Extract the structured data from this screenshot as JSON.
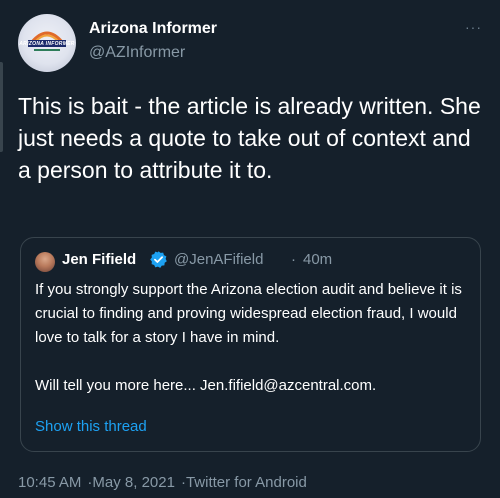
{
  "author": {
    "name": "Arizona Informer",
    "handle": "@AZInformer",
    "avatar_text": "ARIZONA INFORMER"
  },
  "tweet": {
    "text": "This is bait - the article is already written. She just needs a quote to take out of context and a person to attribute it to."
  },
  "quoted": {
    "name": "Jen Fifield",
    "handle": "@JenAFifield",
    "separator": "·",
    "time": "40m",
    "body": "If you strongly support the Arizona election audit and believe it is crucial to finding and proving widespread election fraud, I would love to talk for a story I have in mind.\n\nWill tell you more here... Jen.fifield@azcentral.com.",
    "show_thread": "Show this thread"
  },
  "meta": {
    "time": "10:45 AM",
    "date": "May 8, 2021",
    "client": "Twitter for Android",
    "separator": "·"
  },
  "icons": {
    "more": "more-dots-icon",
    "verified": "verified-badge-icon"
  },
  "colors": {
    "background": "#15202b",
    "link": "#1da1f2",
    "secondary_text": "#8899a6",
    "border": "#38444d"
  }
}
